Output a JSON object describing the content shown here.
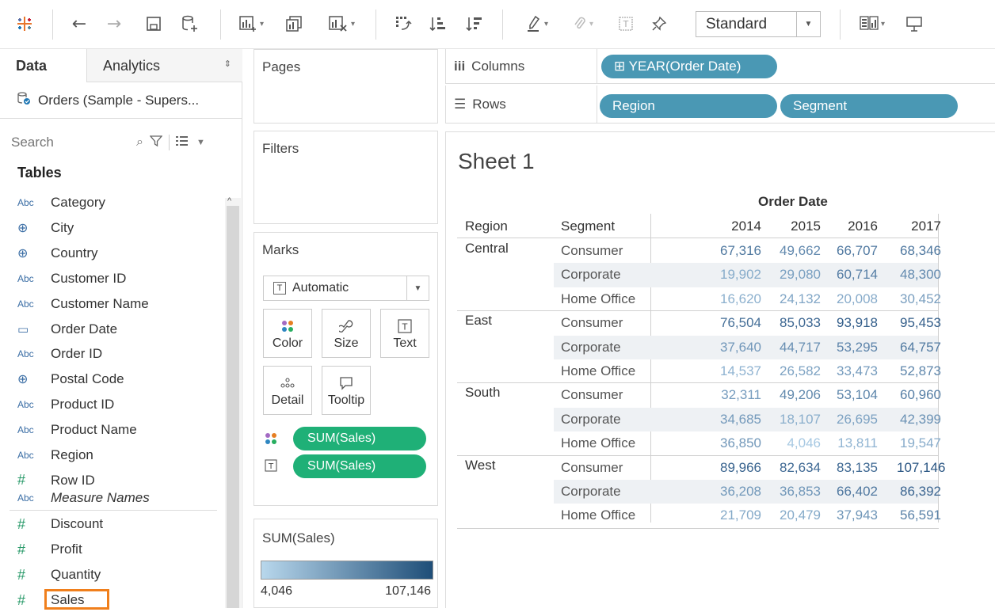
{
  "toolbar": {
    "items": [
      {
        "name": "tableau-logo-icon"
      },
      {
        "name": "back-arrow-icon"
      },
      {
        "name": "forward-arrow-icon"
      },
      {
        "name": "save-icon"
      },
      {
        "name": "new-datasource-icon"
      },
      {
        "name": "new-worksheet-icon"
      },
      {
        "name": "duplicate-icon"
      },
      {
        "name": "clear-sheet-icon"
      },
      {
        "name": "swap-icon"
      },
      {
        "name": "sort-ascending-icon"
      },
      {
        "name": "sort-descending-icon"
      },
      {
        "name": "highlight-icon"
      },
      {
        "name": "group-icon"
      },
      {
        "name": "label-icon"
      },
      {
        "name": "pin-icon"
      },
      {
        "name": "show-me-icon"
      },
      {
        "name": "presentation-icon"
      }
    ],
    "fit_select": "Standard"
  },
  "left_panel": {
    "tabs": {
      "data": "Data",
      "analytics": "Analytics"
    },
    "datasource": "Orders (Sample - Supers...",
    "search_placeholder": "Search",
    "tables_heading": "Tables",
    "fields": [
      {
        "type": "abc",
        "type_label": "Abc",
        "label": "Category"
      },
      {
        "type": "geo",
        "type_label": "⊕",
        "label": "City"
      },
      {
        "type": "geo",
        "type_label": "⊕",
        "label": "Country"
      },
      {
        "type": "abc",
        "type_label": "Abc",
        "label": "Customer ID"
      },
      {
        "type": "abc",
        "type_label": "Abc",
        "label": "Customer Name"
      },
      {
        "type": "dt",
        "type_label": "▭",
        "label": "Order Date"
      },
      {
        "type": "abc",
        "type_label": "Abc",
        "label": "Order ID"
      },
      {
        "type": "geo",
        "type_label": "⊕",
        "label": "Postal Code"
      },
      {
        "type": "abc",
        "type_label": "Abc",
        "label": "Product ID"
      },
      {
        "type": "abc",
        "type_label": "Abc",
        "label": "Product Name"
      },
      {
        "type": "abc",
        "type_label": "Abc",
        "label": "Region"
      },
      {
        "type": "num",
        "type_label": "#",
        "label": "Row ID"
      },
      {
        "type": "abc",
        "type_label": "Abc",
        "label": "Measure Names"
      }
    ],
    "measures": [
      {
        "type": "num",
        "type_label": "#",
        "label": "Discount"
      },
      {
        "type": "num",
        "type_label": "#",
        "label": "Profit"
      },
      {
        "type": "num",
        "type_label": "#",
        "label": "Quantity"
      },
      {
        "type": "num",
        "type_label": "#",
        "label": "Sales"
      }
    ]
  },
  "shelves": {
    "pages": "Pages",
    "filters": "Filters",
    "marks": "Marks",
    "mark_type": "Automatic",
    "mark_buttons": [
      "Color",
      "Size",
      "Text",
      "Detail",
      "Tooltip"
    ],
    "mark_pills": [
      "SUM(Sales)",
      "SUM(Sales)"
    ],
    "legend_title": "SUM(Sales)",
    "legend_min": "4,046",
    "legend_max": "107,146",
    "legend_colors": {
      "low": "#b8d7ec",
      "high": "#1f4e78"
    }
  },
  "columns": {
    "label": "Columns",
    "pills": [
      "⊞ YEAR(Order Date)"
    ]
  },
  "rows": {
    "label": "Rows",
    "pills": [
      "Region",
      "Segment"
    ]
  },
  "sheet": {
    "title": "Sheet 1",
    "column_group_header": "Order Date",
    "header_region": "Region",
    "header_segment": "Segment",
    "years": [
      "2014",
      "2015",
      "2016",
      "2017"
    ],
    "regions": [
      {
        "name": "Central",
        "rows": [
          {
            "segment": "Consumer",
            "values": [
              "67,316",
              "49,662",
              "66,707",
              "68,346"
            ]
          },
          {
            "segment": "Corporate",
            "values": [
              "19,902",
              "29,080",
              "60,714",
              "48,300"
            ]
          },
          {
            "segment": "Home Office",
            "values": [
              "16,620",
              "24,132",
              "20,008",
              "30,452"
            ]
          }
        ]
      },
      {
        "name": "East",
        "rows": [
          {
            "segment": "Consumer",
            "values": [
              "76,504",
              "85,033",
              "93,918",
              "95,453"
            ]
          },
          {
            "segment": "Corporate",
            "values": [
              "37,640",
              "44,717",
              "53,295",
              "64,757"
            ]
          },
          {
            "segment": "Home Office",
            "values": [
              "14,537",
              "26,582",
              "33,473",
              "52,873"
            ]
          }
        ]
      },
      {
        "name": "South",
        "rows": [
          {
            "segment": "Consumer",
            "values": [
              "32,311",
              "49,206",
              "53,104",
              "60,960"
            ]
          },
          {
            "segment": "Corporate",
            "values": [
              "34,685",
              "18,107",
              "26,695",
              "42,399"
            ]
          },
          {
            "segment": "Home Office",
            "values": [
              "36,850",
              "4,046",
              "13,811",
              "19,547"
            ]
          }
        ]
      },
      {
        "name": "West",
        "rows": [
          {
            "segment": "Consumer",
            "values": [
              "89,966",
              "82,634",
              "83,135",
              "107,146"
            ]
          },
          {
            "segment": "Corporate",
            "values": [
              "36,208",
              "36,853",
              "66,402",
              "86,392"
            ]
          },
          {
            "segment": "Home Office",
            "values": [
              "21,709",
              "20,479",
              "37,943",
              "56,591"
            ]
          }
        ]
      }
    ]
  }
}
